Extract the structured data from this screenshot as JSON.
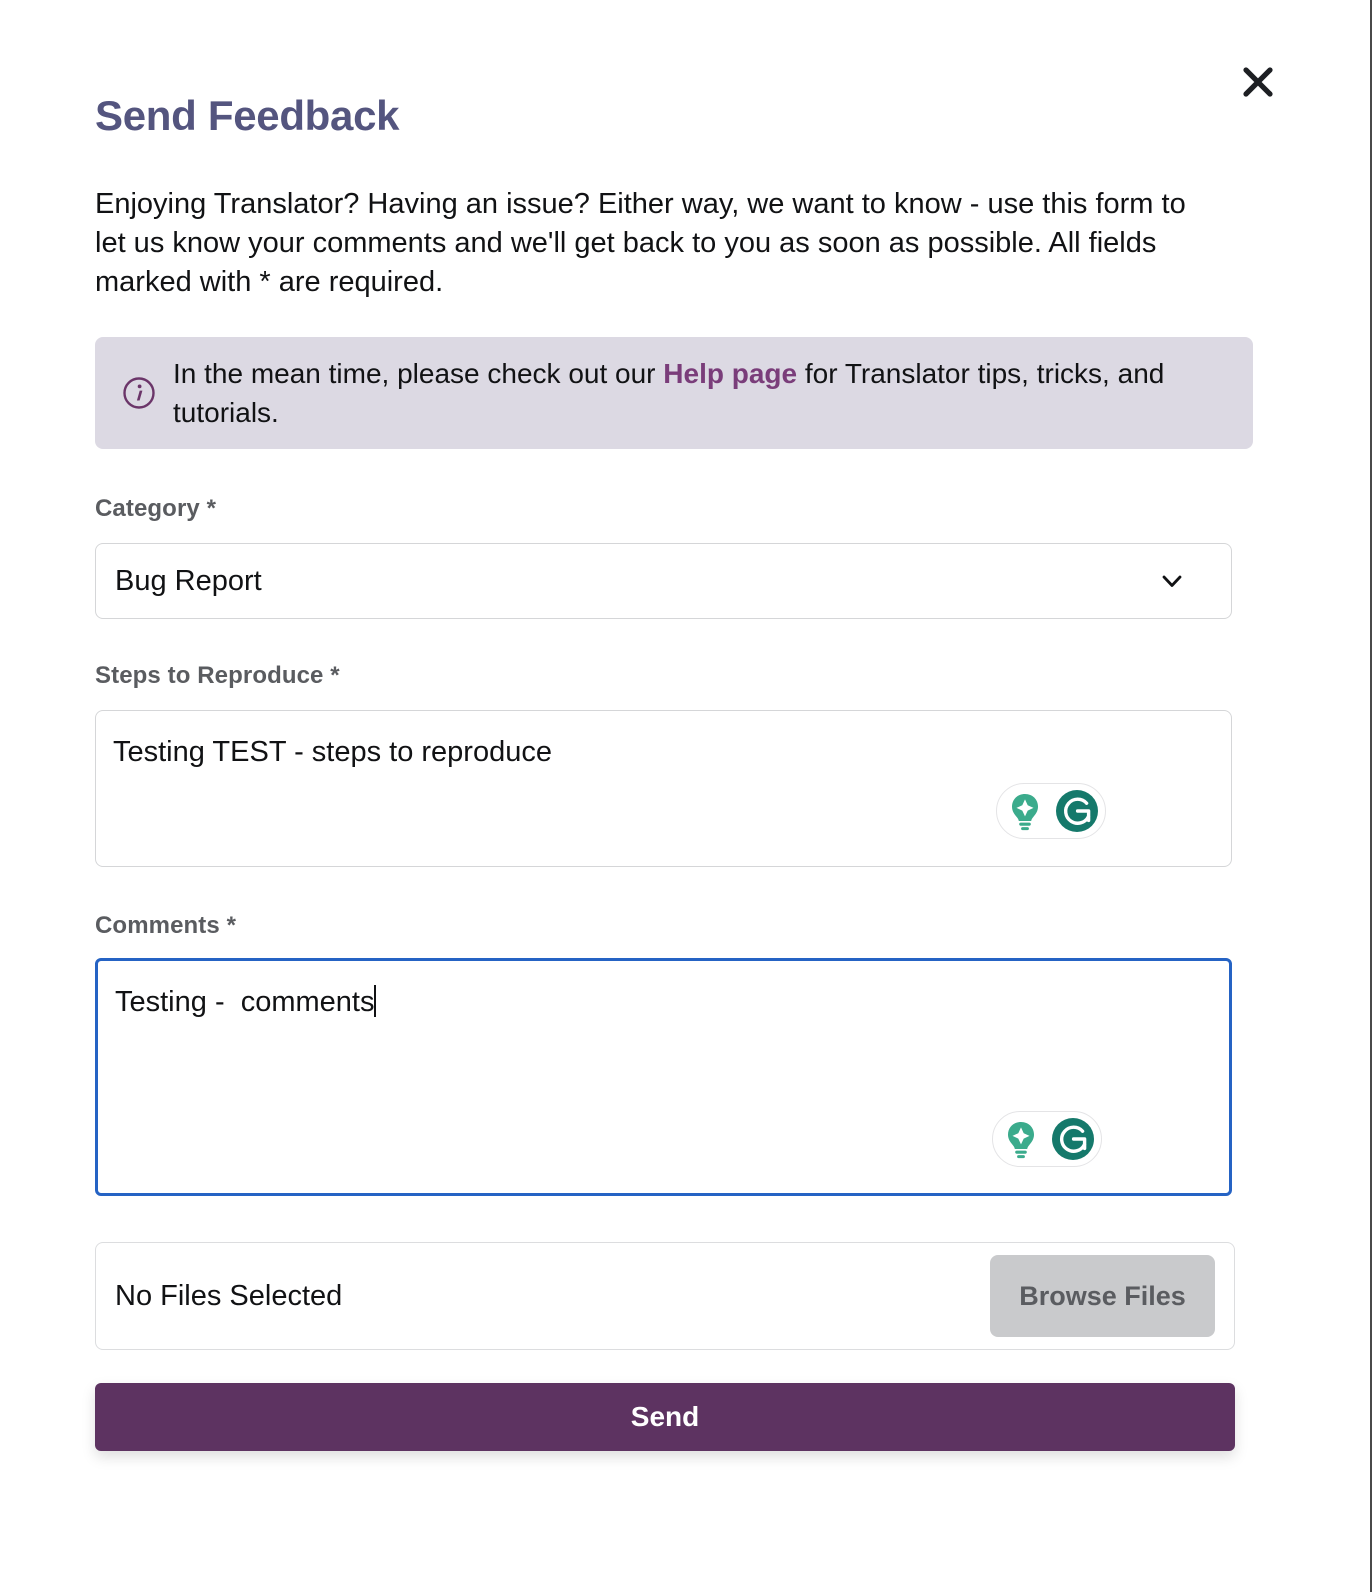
{
  "dialog": {
    "title": "Send Feedback",
    "close_label": "×",
    "intro": "Enjoying Translator? Having an issue? Either way, we want to know - use this form to let us know your comments and we'll get back to you as soon as possible. All fields marked with * are required."
  },
  "info_banner": {
    "text_before": "In the mean time, please check out our ",
    "link_text": "Help page",
    "text_after": " for Translator tips, tricks, and tutorials.",
    "icon": "info-circle-icon",
    "background": "#dcd9e3",
    "link_color": "#7a3d7a"
  },
  "fields": {
    "category": {
      "label": "Category *",
      "value": "Bug Report",
      "options": [
        "Bug Report"
      ],
      "chevron_icon": "chevron-down-icon"
    },
    "steps": {
      "label": "Steps to Reproduce *",
      "value": "Testing TEST - steps to reproduce",
      "placeholder": ""
    },
    "comments": {
      "label": "Comments *",
      "value": "Testing -  comments",
      "placeholder": "",
      "focused": true,
      "focus_color": "#2563c4"
    }
  },
  "grammarly": {
    "suggestion_icon": "lightbulb-icon",
    "logo_icon": "grammarly-g-icon",
    "lightbulb_color": "#3bab8c",
    "logo_color": "#15796b"
  },
  "file_upload": {
    "status": "No Files Selected",
    "browse_label": "Browse Files",
    "browse_background": "#c9cacc"
  },
  "submit": {
    "label": "Send",
    "background": "#5d3361",
    "text_color": "#ffffff"
  },
  "colors": {
    "title": "#54557f",
    "label": "#5a5c60",
    "body_text": "#111214"
  }
}
